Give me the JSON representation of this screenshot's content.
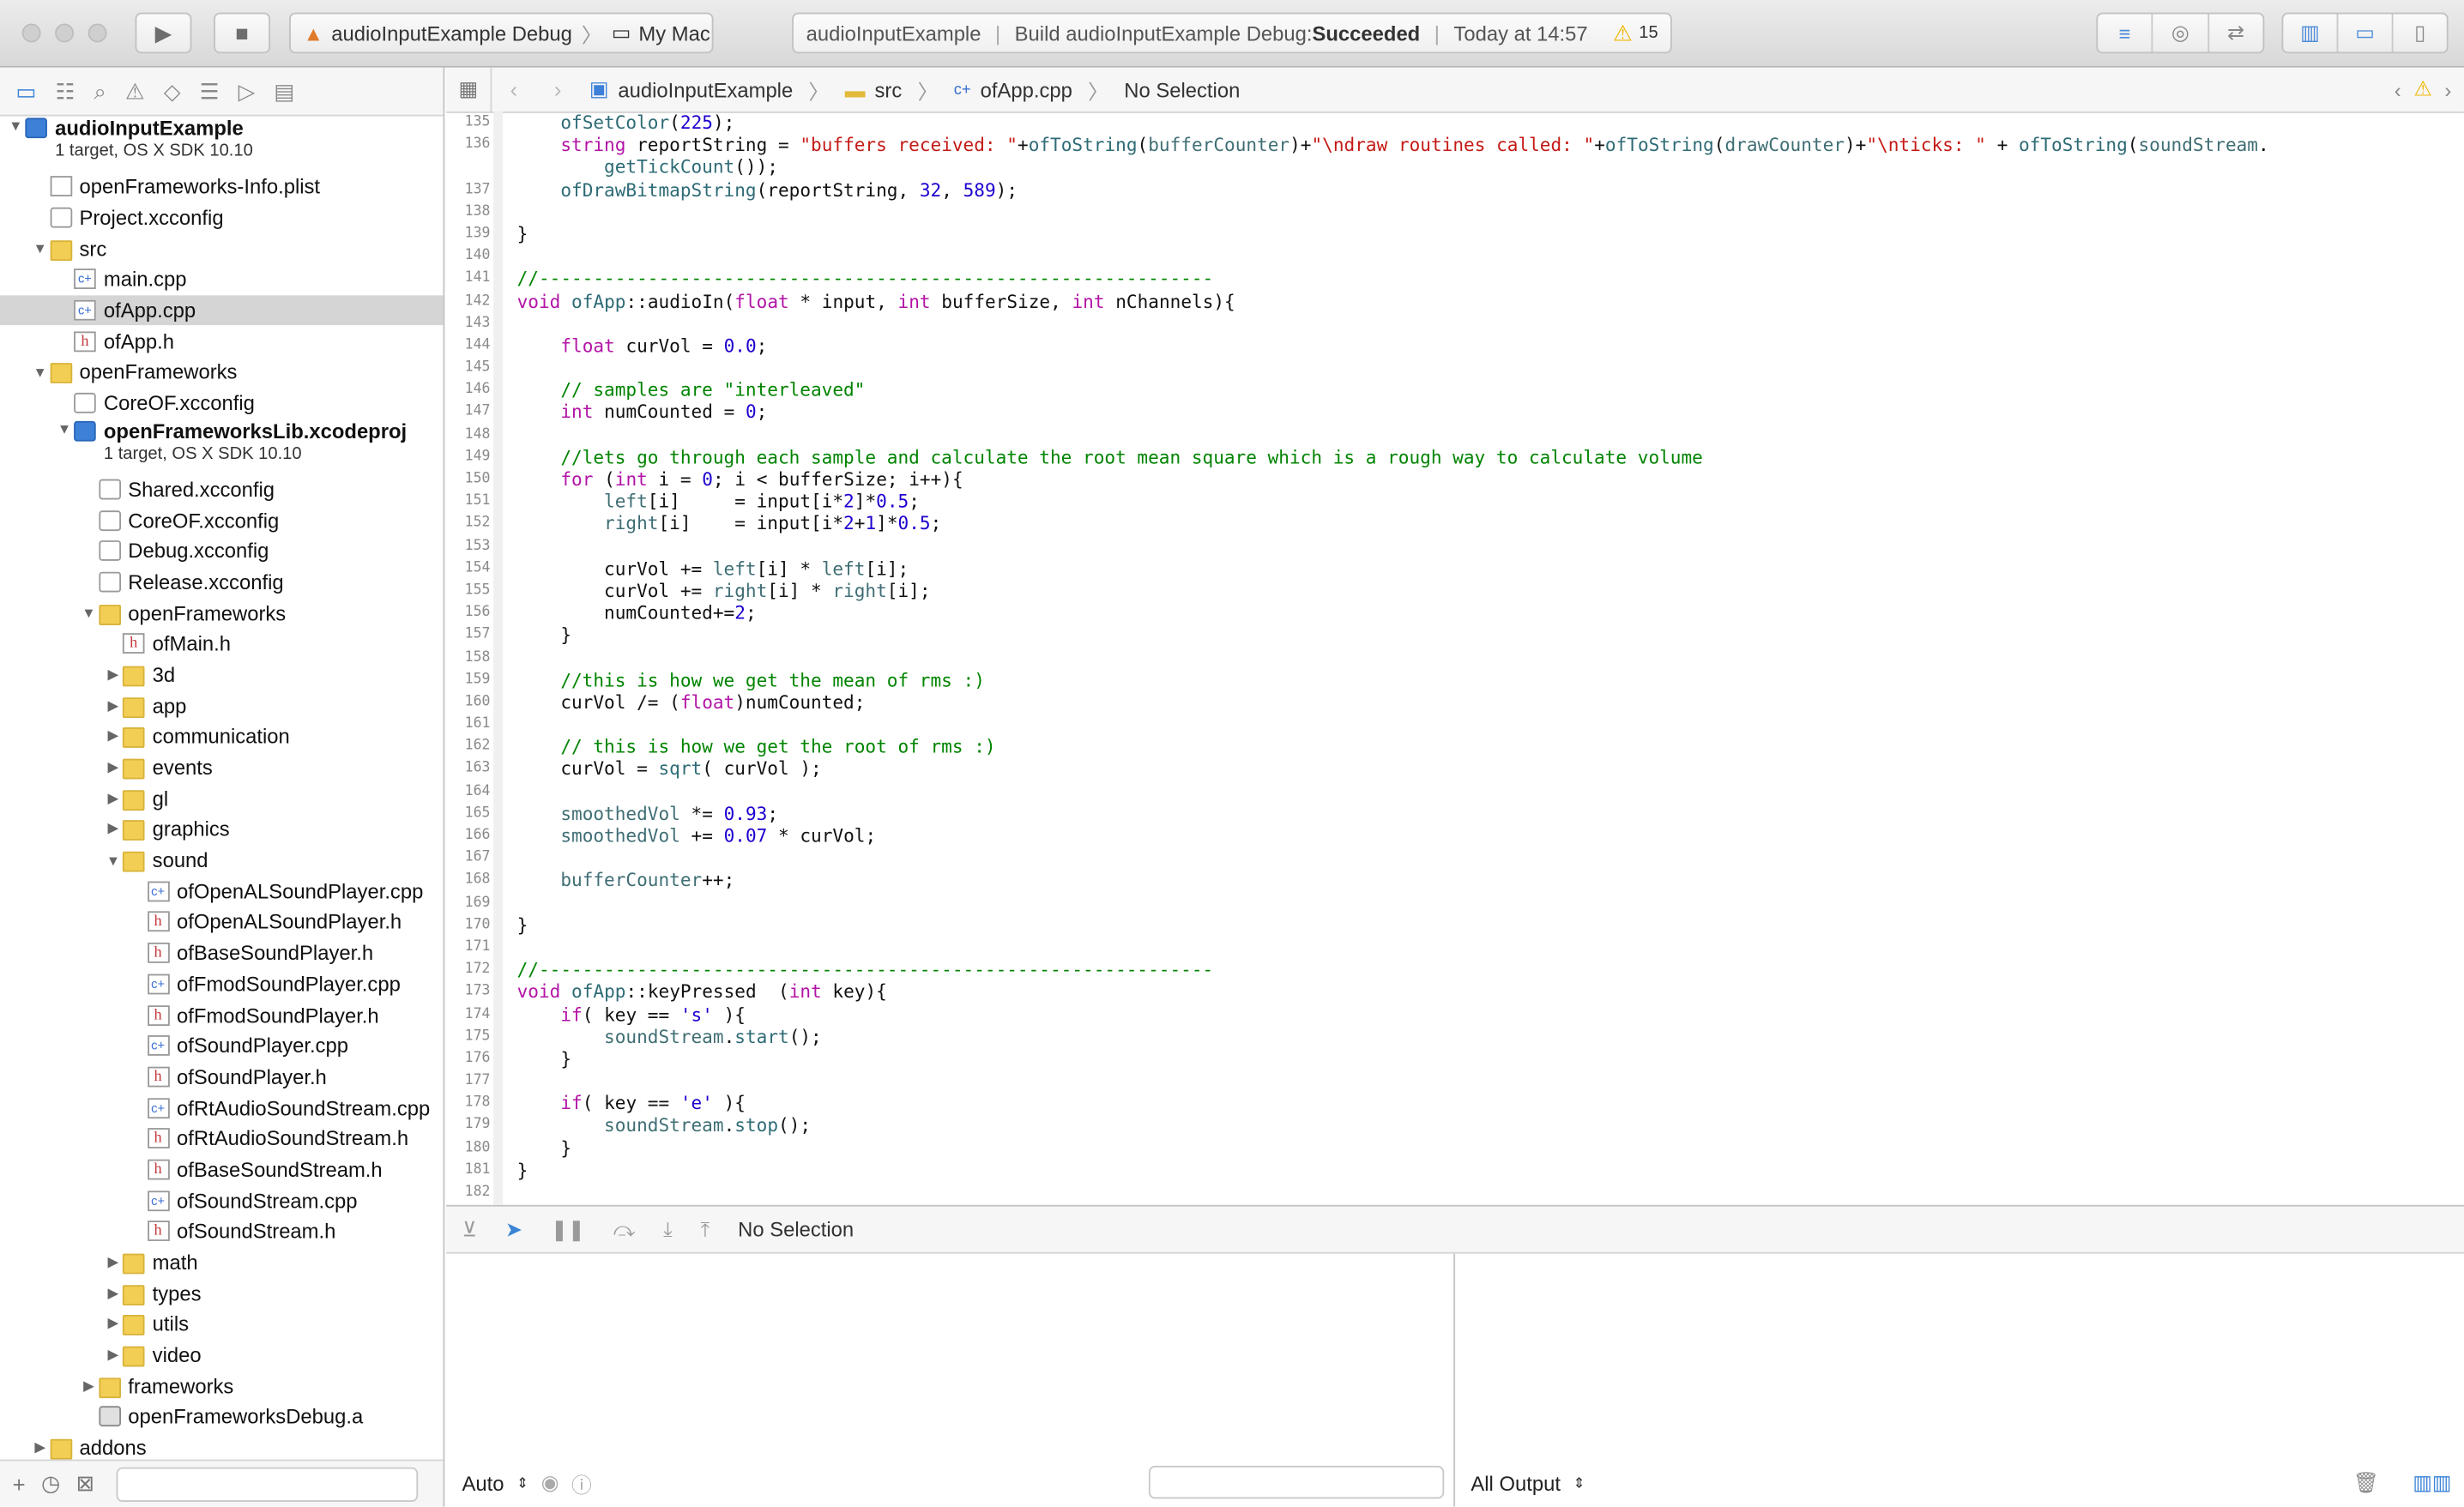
{
  "toolbar": {
    "scheme_target": "audioInputExample Debug",
    "destination": "My Mac",
    "activity_project": "audioInputExample",
    "activity_status_prefix": "Build audioInputExample Debug: ",
    "activity_status_result": "Succeeded",
    "activity_time": "Today at 14:57",
    "warning_count": "15"
  },
  "navigator": {
    "items": [
      {
        "indent": 0,
        "tri": "▼",
        "icon": "proj",
        "label": "audioInputExample",
        "sub": "1 target, OS X SDK 10.10",
        "bold": true
      },
      {
        "indent": 1,
        "tri": "",
        "icon": "plist",
        "label": "openFrameworks-Info.plist"
      },
      {
        "indent": 1,
        "tri": "",
        "icon": "cfg",
        "label": "Project.xcconfig"
      },
      {
        "indent": 1,
        "tri": "▼",
        "icon": "folder",
        "label": "src"
      },
      {
        "indent": 2,
        "tri": "",
        "icon": "cpp",
        "label": "main.cpp"
      },
      {
        "indent": 2,
        "tri": "",
        "icon": "cpp",
        "label": "ofApp.cpp",
        "selected": true
      },
      {
        "indent": 2,
        "tri": "",
        "icon": "hfile",
        "label": "ofApp.h"
      },
      {
        "indent": 1,
        "tri": "▼",
        "icon": "folder",
        "label": "openFrameworks"
      },
      {
        "indent": 2,
        "tri": "",
        "icon": "cfg",
        "label": "CoreOF.xcconfig"
      },
      {
        "indent": 2,
        "tri": "▼",
        "icon": "proj",
        "label": "openFrameworksLib.xcodeproj",
        "sub": "1 target, OS X SDK 10.10",
        "bold": true
      },
      {
        "indent": 3,
        "tri": "",
        "icon": "cfg",
        "label": "Shared.xcconfig"
      },
      {
        "indent": 3,
        "tri": "",
        "icon": "cfg",
        "label": "CoreOF.xcconfig"
      },
      {
        "indent": 3,
        "tri": "",
        "icon": "cfg",
        "label": "Debug.xcconfig"
      },
      {
        "indent": 3,
        "tri": "",
        "icon": "cfg",
        "label": "Release.xcconfig"
      },
      {
        "indent": 3,
        "tri": "▼",
        "icon": "folder",
        "label": "openFrameworks"
      },
      {
        "indent": 4,
        "tri": "",
        "icon": "hfile",
        "label": "ofMain.h"
      },
      {
        "indent": 4,
        "tri": "▶",
        "icon": "folder",
        "label": "3d"
      },
      {
        "indent": 4,
        "tri": "▶",
        "icon": "folder",
        "label": "app"
      },
      {
        "indent": 4,
        "tri": "▶",
        "icon": "folder",
        "label": "communication"
      },
      {
        "indent": 4,
        "tri": "▶",
        "icon": "folder",
        "label": "events"
      },
      {
        "indent": 4,
        "tri": "▶",
        "icon": "folder",
        "label": "gl"
      },
      {
        "indent": 4,
        "tri": "▶",
        "icon": "folder",
        "label": "graphics"
      },
      {
        "indent": 4,
        "tri": "▼",
        "icon": "folder",
        "label": "sound"
      },
      {
        "indent": 5,
        "tri": "",
        "icon": "cpp",
        "label": "ofOpenALSoundPlayer.cpp"
      },
      {
        "indent": 5,
        "tri": "",
        "icon": "hfile",
        "label": "ofOpenALSoundPlayer.h"
      },
      {
        "indent": 5,
        "tri": "",
        "icon": "hfile",
        "label": "ofBaseSoundPlayer.h"
      },
      {
        "indent": 5,
        "tri": "",
        "icon": "cpp",
        "label": "ofFmodSoundPlayer.cpp"
      },
      {
        "indent": 5,
        "tri": "",
        "icon": "hfile",
        "label": "ofFmodSoundPlayer.h"
      },
      {
        "indent": 5,
        "tri": "",
        "icon": "cpp",
        "label": "ofSoundPlayer.cpp"
      },
      {
        "indent": 5,
        "tri": "",
        "icon": "hfile",
        "label": "ofSoundPlayer.h"
      },
      {
        "indent": 5,
        "tri": "",
        "icon": "cpp",
        "label": "ofRtAudioSoundStream.cpp"
      },
      {
        "indent": 5,
        "tri": "",
        "icon": "hfile",
        "label": "ofRtAudioSoundStream.h"
      },
      {
        "indent": 5,
        "tri": "",
        "icon": "hfile",
        "label": "ofBaseSoundStream.h"
      },
      {
        "indent": 5,
        "tri": "",
        "icon": "cpp",
        "label": "ofSoundStream.cpp"
      },
      {
        "indent": 5,
        "tri": "",
        "icon": "hfile",
        "label": "ofSoundStream.h"
      },
      {
        "indent": 4,
        "tri": "▶",
        "icon": "folder",
        "label": "math"
      },
      {
        "indent": 4,
        "tri": "▶",
        "icon": "folder",
        "label": "types"
      },
      {
        "indent": 4,
        "tri": "▶",
        "icon": "folder",
        "label": "utils"
      },
      {
        "indent": 4,
        "tri": "▶",
        "icon": "folder",
        "label": "video"
      },
      {
        "indent": 3,
        "tri": "▶",
        "icon": "folder",
        "label": "frameworks"
      },
      {
        "indent": 3,
        "tri": "",
        "icon": "lib",
        "label": "openFrameworksDebug.a"
      },
      {
        "indent": 1,
        "tri": "▶",
        "icon": "folder",
        "label": "addons"
      }
    ]
  },
  "jumpbar": {
    "project": "audioInputExample",
    "group": "src",
    "file": "ofApp.cpp",
    "selection": "No Selection"
  },
  "editor": {
    "lines": [
      {
        "n": "135",
        "segs": [
          [
            "    ",
            ""
          ],
          [
            "ofSetColor",
            "fn"
          ],
          [
            "(",
            ""
          ],
          [
            "225",
            "num"
          ],
          [
            ");",
            ""
          ]
        ]
      },
      {
        "n": "136",
        "segs": [
          [
            "    ",
            ""
          ],
          [
            "string",
            "kw"
          ],
          [
            " reportString = ",
            ""
          ],
          [
            "\"buffers received: \"",
            "str"
          ],
          [
            "+",
            ""
          ],
          [
            "ofToString",
            "fn"
          ],
          [
            "(",
            ""
          ],
          [
            "bufferCounter",
            "mem"
          ],
          [
            ")+",
            ""
          ],
          [
            "\"\\ndraw routines called: \"",
            "str"
          ],
          [
            "+",
            ""
          ],
          [
            "ofToString",
            "fn"
          ],
          [
            "(",
            ""
          ],
          [
            "drawCounter",
            "mem"
          ],
          [
            ")+",
            ""
          ],
          [
            "\"\\nticks: \"",
            "str"
          ],
          [
            " + ",
            ""
          ],
          [
            "ofToString",
            "fn"
          ],
          [
            "(",
            ""
          ],
          [
            "soundStream",
            "mem"
          ],
          [
            ".",
            ""
          ]
        ]
      },
      {
        "n": "",
        "segs": [
          [
            "        ",
            ""
          ],
          [
            "getTickCount",
            "fn"
          ],
          [
            "());",
            ""
          ]
        ]
      },
      {
        "n": "137",
        "segs": [
          [
            "    ",
            ""
          ],
          [
            "ofDrawBitmapString",
            "fn"
          ],
          [
            "(reportString, ",
            ""
          ],
          [
            "32",
            "num"
          ],
          [
            ", ",
            ""
          ],
          [
            "589",
            "num"
          ],
          [
            ");",
            ""
          ]
        ]
      },
      {
        "n": "138",
        "segs": []
      },
      {
        "n": "139",
        "segs": [
          [
            "}",
            ""
          ]
        ]
      },
      {
        "n": "140",
        "segs": []
      },
      {
        "n": "141",
        "segs": [
          [
            "//--------------------------------------------------------------",
            "cm"
          ]
        ]
      },
      {
        "n": "142",
        "segs": [
          [
            "void",
            "kw"
          ],
          [
            " ",
            ""
          ],
          [
            "ofApp",
            "fn"
          ],
          [
            "::audioIn(",
            ""
          ],
          [
            "float",
            "kw"
          ],
          [
            " * input, ",
            ""
          ],
          [
            "int",
            "kw"
          ],
          [
            " bufferSize, ",
            ""
          ],
          [
            "int",
            "kw"
          ],
          [
            " nChannels){",
            ""
          ]
        ]
      },
      {
        "n": "143",
        "segs": []
      },
      {
        "n": "144",
        "segs": [
          [
            "    ",
            ""
          ],
          [
            "float",
            "kw"
          ],
          [
            " curVol = ",
            ""
          ],
          [
            "0.0",
            "num"
          ],
          [
            ";",
            ""
          ]
        ]
      },
      {
        "n": "145",
        "segs": []
      },
      {
        "n": "146",
        "segs": [
          [
            "    // samples are \"interleaved\"",
            "cm"
          ]
        ]
      },
      {
        "n": "147",
        "segs": [
          [
            "    ",
            ""
          ],
          [
            "int",
            "kw"
          ],
          [
            " numCounted = ",
            ""
          ],
          [
            "0",
            "num"
          ],
          [
            ";",
            ""
          ]
        ]
      },
      {
        "n": "148",
        "segs": []
      },
      {
        "n": "149",
        "segs": [
          [
            "    //lets go through each sample and calculate the root mean square which is a rough way to calculate volume",
            "cm"
          ]
        ]
      },
      {
        "n": "150",
        "segs": [
          [
            "    ",
            ""
          ],
          [
            "for",
            "kw"
          ],
          [
            " (",
            ""
          ],
          [
            "int",
            "kw"
          ],
          [
            " i = ",
            ""
          ],
          [
            "0",
            "num"
          ],
          [
            "; i < bufferSize; i++){",
            ""
          ]
        ]
      },
      {
        "n": "151",
        "segs": [
          [
            "        ",
            ""
          ],
          [
            "left",
            "mem"
          ],
          [
            "[i]     = input[i*",
            ""
          ],
          [
            "2",
            "num"
          ],
          [
            "]*",
            ""
          ],
          [
            "0.5",
            "num"
          ],
          [
            ";",
            ""
          ]
        ]
      },
      {
        "n": "152",
        "segs": [
          [
            "        ",
            ""
          ],
          [
            "right",
            "mem"
          ],
          [
            "[i]    = input[i*",
            ""
          ],
          [
            "2",
            "num"
          ],
          [
            "+",
            ""
          ],
          [
            "1",
            "num"
          ],
          [
            "]*",
            ""
          ],
          [
            "0.5",
            "num"
          ],
          [
            ";",
            ""
          ]
        ]
      },
      {
        "n": "153",
        "segs": []
      },
      {
        "n": "154",
        "segs": [
          [
            "        curVol += ",
            ""
          ],
          [
            "left",
            "mem"
          ],
          [
            "[i] * ",
            ""
          ],
          [
            "left",
            "mem"
          ],
          [
            "[i];",
            ""
          ]
        ]
      },
      {
        "n": "155",
        "segs": [
          [
            "        curVol += ",
            ""
          ],
          [
            "right",
            "mem"
          ],
          [
            "[i] * ",
            ""
          ],
          [
            "right",
            "mem"
          ],
          [
            "[i];",
            ""
          ]
        ]
      },
      {
        "n": "156",
        "segs": [
          [
            "        numCounted+=",
            ""
          ],
          [
            "2",
            "num"
          ],
          [
            ";",
            ""
          ]
        ]
      },
      {
        "n": "157",
        "segs": [
          [
            "    }",
            ""
          ]
        ]
      },
      {
        "n": "158",
        "segs": []
      },
      {
        "n": "159",
        "segs": [
          [
            "    //this is how we get the mean of rms :)",
            "cm"
          ]
        ]
      },
      {
        "n": "160",
        "segs": [
          [
            "    curVol /= (",
            ""
          ],
          [
            "float",
            "kw"
          ],
          [
            ")numCounted;",
            ""
          ]
        ]
      },
      {
        "n": "161",
        "segs": []
      },
      {
        "n": "162",
        "segs": [
          [
            "    // this is how we get the root of rms :)",
            "cm"
          ]
        ]
      },
      {
        "n": "163",
        "segs": [
          [
            "    curVol = ",
            ""
          ],
          [
            "sqrt",
            "fn"
          ],
          [
            "( curVol );",
            ""
          ]
        ]
      },
      {
        "n": "164",
        "segs": []
      },
      {
        "n": "165",
        "segs": [
          [
            "    ",
            ""
          ],
          [
            "smoothedVol",
            "mem"
          ],
          [
            " *= ",
            ""
          ],
          [
            "0.93",
            "num"
          ],
          [
            ";",
            ""
          ]
        ]
      },
      {
        "n": "166",
        "segs": [
          [
            "    ",
            ""
          ],
          [
            "smoothedVol",
            "mem"
          ],
          [
            " += ",
            ""
          ],
          [
            "0.07",
            "num"
          ],
          [
            " * curVol;",
            ""
          ]
        ]
      },
      {
        "n": "167",
        "segs": []
      },
      {
        "n": "168",
        "segs": [
          [
            "    ",
            ""
          ],
          [
            "bufferCounter",
            "mem"
          ],
          [
            "++;",
            ""
          ]
        ]
      },
      {
        "n": "169",
        "segs": []
      },
      {
        "n": "170",
        "segs": [
          [
            "}",
            ""
          ]
        ]
      },
      {
        "n": "171",
        "segs": []
      },
      {
        "n": "172",
        "segs": [
          [
            "//--------------------------------------------------------------",
            "cm"
          ]
        ]
      },
      {
        "n": "173",
        "segs": [
          [
            "void",
            "kw"
          ],
          [
            " ",
            ""
          ],
          [
            "ofApp",
            "fn"
          ],
          [
            "::keyPressed  (",
            ""
          ],
          [
            "int",
            "kw"
          ],
          [
            " key){",
            ""
          ]
        ]
      },
      {
        "n": "174",
        "segs": [
          [
            "    ",
            ""
          ],
          [
            "if",
            "kw"
          ],
          [
            "( key == ",
            ""
          ],
          [
            "'s'",
            "num"
          ],
          [
            " ){",
            ""
          ]
        ]
      },
      {
        "n": "175",
        "segs": [
          [
            "        ",
            ""
          ],
          [
            "soundStream",
            "mem"
          ],
          [
            ".",
            ""
          ],
          [
            "start",
            "fn"
          ],
          [
            "();",
            ""
          ]
        ]
      },
      {
        "n": "176",
        "segs": [
          [
            "    }",
            ""
          ]
        ]
      },
      {
        "n": "177",
        "segs": []
      },
      {
        "n": "178",
        "segs": [
          [
            "    ",
            ""
          ],
          [
            "if",
            "kw"
          ],
          [
            "( key == ",
            ""
          ],
          [
            "'e'",
            "num"
          ],
          [
            " ){",
            ""
          ]
        ]
      },
      {
        "n": "179",
        "segs": [
          [
            "        ",
            ""
          ],
          [
            "soundStream",
            "mem"
          ],
          [
            ".",
            ""
          ],
          [
            "stop",
            "fn"
          ],
          [
            "();",
            ""
          ]
        ]
      },
      {
        "n": "180",
        "segs": [
          [
            "    }",
            ""
          ]
        ]
      },
      {
        "n": "181",
        "segs": [
          [
            "}",
            ""
          ]
        ]
      },
      {
        "n": "182",
        "segs": []
      }
    ]
  },
  "debug": {
    "selection": "No Selection",
    "variables_scope": "Auto",
    "console_output": "All Output"
  },
  "colors": {
    "accent": "#3b83d6",
    "keyword": "#b314a6",
    "string": "#c41a16",
    "number": "#1c00cf",
    "comment": "#008400",
    "warning": "#f1b600"
  }
}
